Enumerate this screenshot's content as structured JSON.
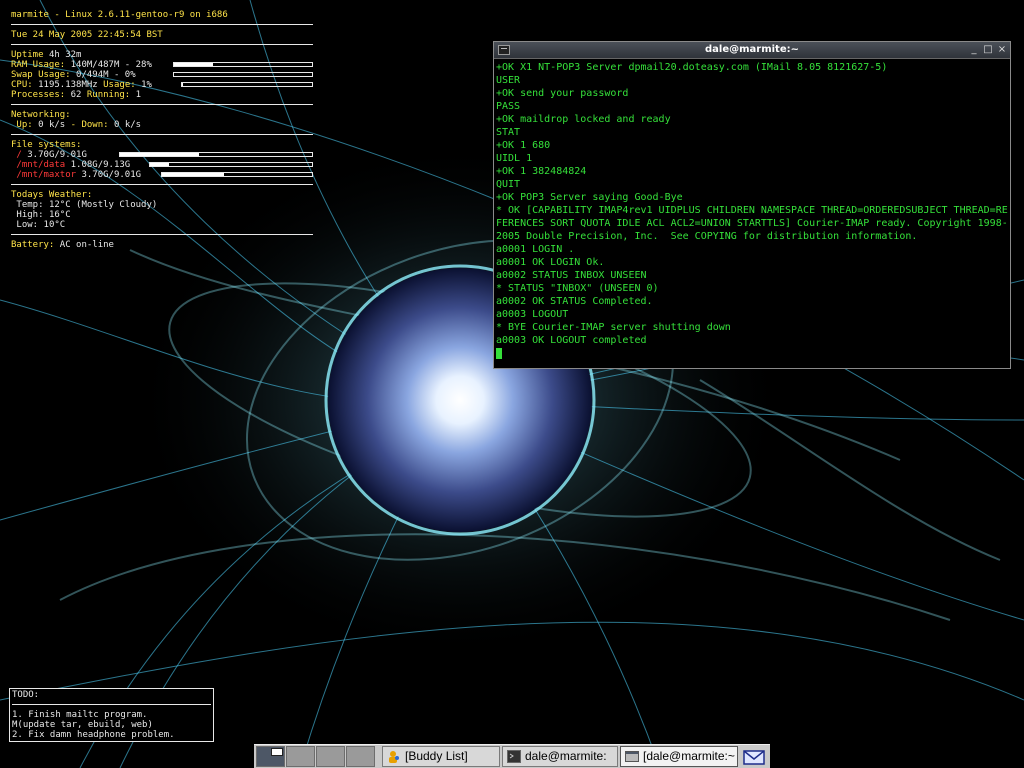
{
  "conky": {
    "header": "marmite - Linux 2.6.11-gentoo-r9 on i686",
    "datetime": "Tue 24 May 2005 22:45:54 BST",
    "uptime_label": "Uptime",
    "uptime_value": "4h 32m",
    "ram_label": "RAM Usage:",
    "ram_value": "140M/487M - 28%",
    "ram_percent": 28,
    "swap_label": "Swap Usage:",
    "swap_value": "0/494M - 0%",
    "swap_percent": 0,
    "cpu_label": "CPU:",
    "cpu_freq": "1195.138MHz",
    "cpu_usage_label": "Usage:",
    "cpu_usage_value": "1%",
    "cpu_percent": 1,
    "processes_label": "Processes:",
    "processes_value": "62",
    "running_label": "Running:",
    "running_value": "1",
    "networking_label": "Networking:",
    "up_label": "Up:",
    "up_value": "0 k/s",
    "down_label": "Down:",
    "down_value": "0 k/s",
    "fs_label": "File systems:",
    "filesystems": [
      {
        "mount": "/",
        "usage": "3.70G/9.01G",
        "fill": 0.41
      },
      {
        "mount": "/mnt/data",
        "usage": "1.08G/9.13G",
        "fill": 0.12
      },
      {
        "mount": "/mnt/maxtor",
        "usage": "3.70G/9.01G",
        "fill": 0.41
      }
    ],
    "weather_label": "Todays Weather:",
    "temp_label": "Temp:",
    "temp_value": "12°C (Mostly Cloudy)",
    "high_label": "High:",
    "high_value": "16°C",
    "low_label": "Low:",
    "low_value": "10°C",
    "battery_label": "Battery:",
    "battery_value": "AC on-line"
  },
  "todo": {
    "title": "TODO:",
    "lines": [
      "1.  Finish mailtc program.",
      "M(update tar, ebuild, web)",
      "2.  Fix damn headphone problem."
    ]
  },
  "terminal": {
    "title": "dale@marmite:~",
    "minimize": "_",
    "maximize": "□",
    "close": "×",
    "lines": [
      "+OK X1 NT-POP3 Server dpmail20.doteasy.com (IMail 8.05 8121627-5)",
      "USER",
      "+OK send your password",
      "PASS",
      "+OK maildrop locked and ready",
      "STAT",
      "+OK 1 680",
      "UIDL 1",
      "+OK 1 382484824",
      "QUIT",
      "+OK POP3 Server saying Good-Bye",
      "* OK [CAPABILITY IMAP4rev1 UIDPLUS CHILDREN NAMESPACE THREAD=ORDEREDSUBJECT THREAD=RE",
      "FERENCES SORT QUOTA IDLE ACL ACL2=UNION STARTTLS] Courier-IMAP ready. Copyright 1998-",
      "2005 Double Precision, Inc.  See COPYING for distribution information.",
      "a0001 LOGIN .",
      "a0001 OK LOGIN Ok.",
      "a0002 STATUS INBOX UNSEEN",
      "* STATUS \"INBOX\" (UNSEEN 0)",
      "a0002 OK STATUS Completed.",
      "a0003 LOGOUT",
      "* BYE Courier-IMAP server shutting down",
      "a0003 OK LOGOUT completed"
    ]
  },
  "taskbar": {
    "tasks": [
      {
        "label": "[Buddy List]",
        "icon": "buddy-icon"
      },
      {
        "label": "dale@marmite:",
        "icon": "terminal-icon"
      },
      {
        "label": "[dale@marmite:~",
        "icon": "window-icon"
      }
    ],
    "mail_icon": "envelope-icon"
  },
  "colors": {
    "terminal_text": "#35e03a",
    "conky_highlight": "#ffe44a",
    "conky_alert": "#ff3a3a",
    "wallpaper_accent": "#4fd6ff"
  }
}
